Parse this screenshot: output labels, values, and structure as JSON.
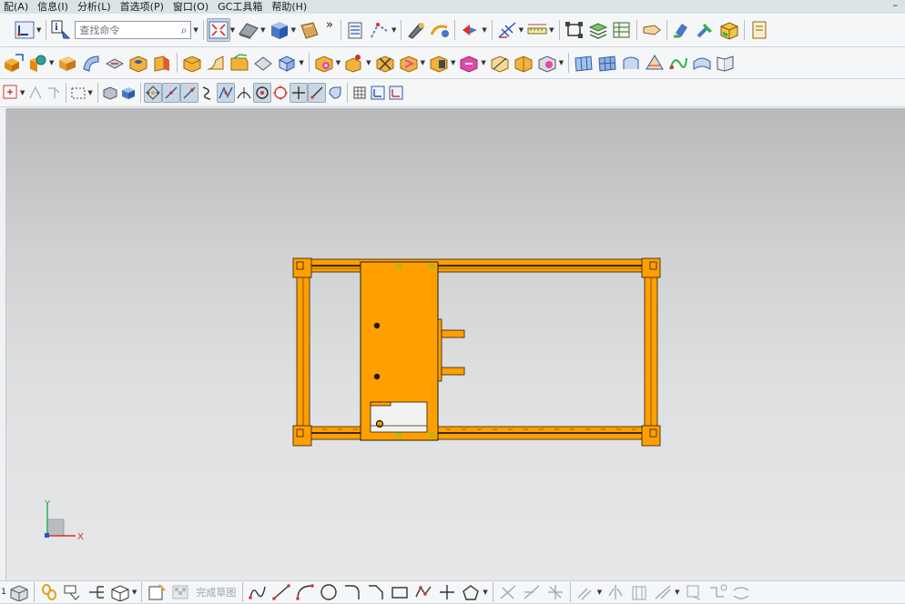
{
  "menubar": {
    "items": [
      "配(A)",
      "信息(I)",
      "分析(L)",
      "首选项(P)",
      "窗口(O)",
      "GC工具箱",
      "帮助(H)"
    ],
    "minimize_glyph": "–"
  },
  "toolbar1": {
    "search_placeholder": "查找命令",
    "overflow_glyph": "»"
  },
  "toolbar_bottom": {
    "finish_sketch_label": "完成草图"
  },
  "axes": {
    "x_label": "X",
    "y_label": "Y"
  },
  "colors": {
    "model_orange": "#ff9f00",
    "model_outline": "#2a1e00",
    "viewport_top": "#b7b9bb",
    "viewport_bottom": "#e6e7e9",
    "axis_x": "#d4342b",
    "axis_y": "#2db14a",
    "axis_z": "#2b53c9"
  },
  "icons": {
    "toolbar1": [
      "wcs-icon",
      "info-icon",
      "search-icon",
      "fit-view-icon",
      "render-style-icon",
      "shaded-cube-icon",
      "texture-icon",
      "layer-icon",
      "snap-icon",
      "measure-icon",
      "sketch-icon",
      "analysis-icon",
      "ruler-icon",
      "assembly-icon",
      "stack-icon",
      "table-icon",
      "tag-icon",
      "part-nav-icon",
      "hammer-icon",
      "box-icon"
    ],
    "toolbar2": [
      "extrude-icon",
      "revolve-icon",
      "block-icon",
      "sweep-icon",
      "boolean-icon",
      "hole-icon",
      "pad-icon",
      "shell-icon",
      "blend-icon",
      "chamfer-icon",
      "draft-icon",
      "pattern-icon",
      "mirror-icon",
      "offset-icon",
      "trim-icon",
      "split-icon",
      "surface-icon"
    ],
    "toolbar3": [
      "snap-point-icon",
      "select-filter-icon",
      "box-select-icon",
      "cube-icon",
      "point-snap-icon",
      "line-snap-icon",
      "curve-snap-icon",
      "intersect-snap-icon",
      "center-snap-icon",
      "quadrant-snap-icon",
      "grid-snap-icon"
    ],
    "bottom": [
      "box-icon",
      "chain-icon",
      "link-icon",
      "branch-icon",
      "cube-icon",
      "sketch-icon",
      "finish-sketch-icon",
      "profile-icon",
      "line-icon",
      "arc-icon",
      "circle-icon",
      "fillet-icon",
      "chamfer-icon",
      "rectangle-icon",
      "polyline-icon",
      "point-icon",
      "polygon-icon"
    ]
  }
}
